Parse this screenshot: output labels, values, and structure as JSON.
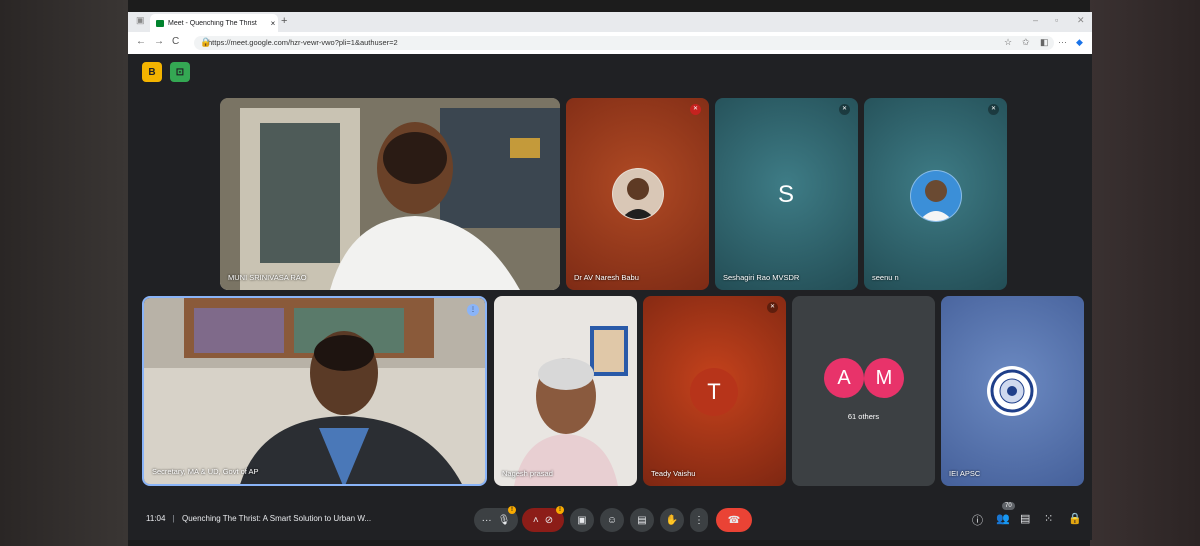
{
  "browser": {
    "tab_title": "Meet - Quenching The Thrist",
    "tab_close": "×",
    "new_tab": "+",
    "url": "https://meet.google.com/hzr-vewr-vwo?pli=1&authuser=2",
    "nav_back": "←",
    "nav_forward": "→",
    "nav_reload": "C"
  },
  "toolbar_badges": [
    {
      "label": "B",
      "color": "#f4b400"
    },
    {
      "label": "⊡",
      "color": "#34a853"
    }
  ],
  "participants_top": [
    {
      "name": "MUNI SRINIVASA RAO",
      "kind": "video"
    },
    {
      "name": "Dr AV Naresh Babu",
      "kind": "photo"
    },
    {
      "name": "Seshagiri Rao MVSDR",
      "kind": "letter",
      "letter": "S"
    },
    {
      "name": "seenu n",
      "kind": "photo"
    }
  ],
  "participants_bottom": [
    {
      "name": "Secretary, MA & UD, Govt of AP",
      "kind": "video"
    },
    {
      "name": "Nagesh prasad",
      "kind": "video"
    },
    {
      "name": "Teady Vaishu",
      "kind": "letter",
      "letter": "T"
    },
    {
      "name": "61 others",
      "kind": "group",
      "letters": [
        "A",
        "M"
      ]
    },
    {
      "name": "IEI APSC",
      "kind": "logo"
    }
  ],
  "bottom_bar": {
    "time": "11:04",
    "separator": "|",
    "meeting_title": "Quenching The Thrist: A Smart Solution to Urban W...",
    "participant_count": "70",
    "warn_badge": "!"
  },
  "colors": {
    "meet_bg": "#202124",
    "end_call": "#ea4335",
    "tile_orange": "#c13b1a",
    "tile_teal": "#2e6b74",
    "tile_dark": "#3c4043",
    "tile_blue": "#5d7bb5"
  }
}
